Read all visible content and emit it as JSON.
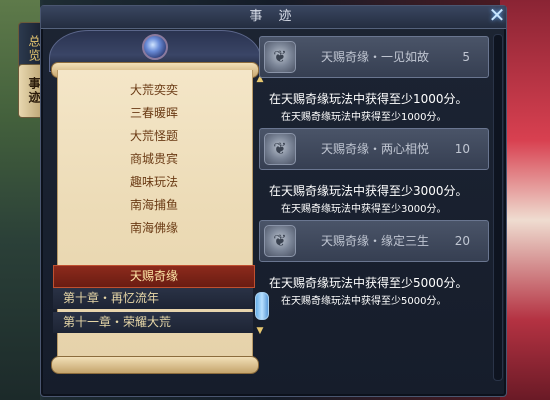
{
  "window": {
    "title": "事 迹"
  },
  "side_tabs": [
    {
      "label": "总览"
    },
    {
      "label": "事迹"
    }
  ],
  "menu": {
    "items": [
      {
        "label": "大荒奕奕"
      },
      {
        "label": "三春暖晖"
      },
      {
        "label": "大荒怪题"
      },
      {
        "label": "商城贵宾"
      },
      {
        "label": "趣味玩法"
      },
      {
        "label": "南海捕鱼"
      },
      {
        "label": "南海佛缘"
      },
      {
        "label": "天赐奇缘"
      },
      {
        "label": "第十章・再忆流年"
      },
      {
        "label": "第十一章・荣耀大荒"
      }
    ],
    "selected": "天赐奇缘"
  },
  "achievements": [
    {
      "name": "天赐奇缘・一见如故",
      "points": "5",
      "desc": "在天赐奇缘玩法中获得至少1000分。",
      "sub": "在天赐奇缘玩法中获得至少1000分。"
    },
    {
      "name": "天赐奇缘・两心相悦",
      "points": "10",
      "desc": "在天赐奇缘玩法中获得至少3000分。",
      "sub": "在天赐奇缘玩法中获得至少3000分。"
    },
    {
      "name": "天赐奇缘・缘定三生",
      "points": "20",
      "desc": "在天赐奇缘玩法中获得至少5000分。",
      "sub": "在天赐奇缘玩法中获得至少5000分。"
    }
  ],
  "icons": {
    "close": "close-icon",
    "achievement": "achievement-badge-icon",
    "scroll_up": "triangle-up-icon",
    "scroll_down": "triangle-down-icon"
  }
}
